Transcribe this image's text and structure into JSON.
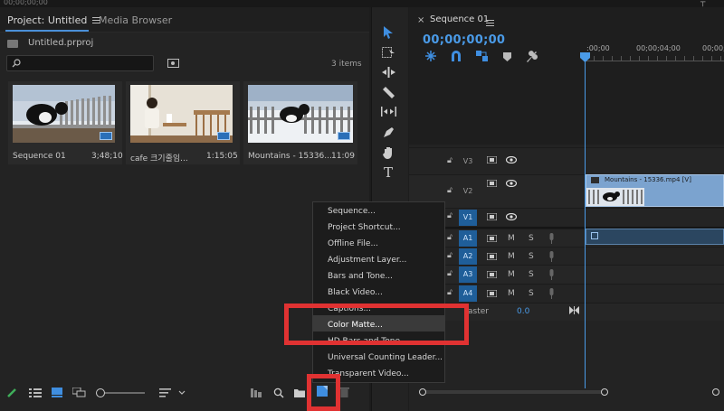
{
  "topstrip": {
    "text": "00;00;00;00"
  },
  "project": {
    "tab_active": "Project: Untitled",
    "tab_inactive": "Media Browser",
    "file_name": "Untitled.prproj",
    "item_count": "3 items",
    "items": [
      {
        "name": "Sequence 01",
        "duration": "3;48;10"
      },
      {
        "name": "cafe 크기줄임...",
        "duration": "1:15:05"
      },
      {
        "name": "Mountains - 15336...",
        "duration": "11:09"
      }
    ]
  },
  "timeline": {
    "tab": "Sequence 01",
    "timecode": "00;00;00;00",
    "ruler": [
      ":00;00",
      "00;00;04;00",
      "00;00;08;00"
    ],
    "clip_video": "Mountains - 15336.mp4 [V]",
    "tracks_video": [
      "V3",
      "V2",
      "V1"
    ],
    "tracks_audio": [
      "A1",
      "A2",
      "A3",
      "A4"
    ],
    "track_m": "M",
    "track_s": "S",
    "master_label": "aster",
    "master_value": "0.0"
  },
  "menu": {
    "items": [
      "Sequence...",
      "Project Shortcut...",
      "Offline File...",
      "Adjustment Layer...",
      "Bars and Tone...",
      "Black Video...",
      "Captions...",
      "Color Matte...",
      "HD Bars and Tone...",
      "Universal Counting Leader...",
      "Transparent Video..."
    ],
    "highlighted": "Color Matte..."
  },
  "colors": {
    "accent": "#4a8fd8",
    "highlight_red": "#e03232",
    "track_selected": "#1f5e99",
    "clip": "#7ba3cf"
  }
}
